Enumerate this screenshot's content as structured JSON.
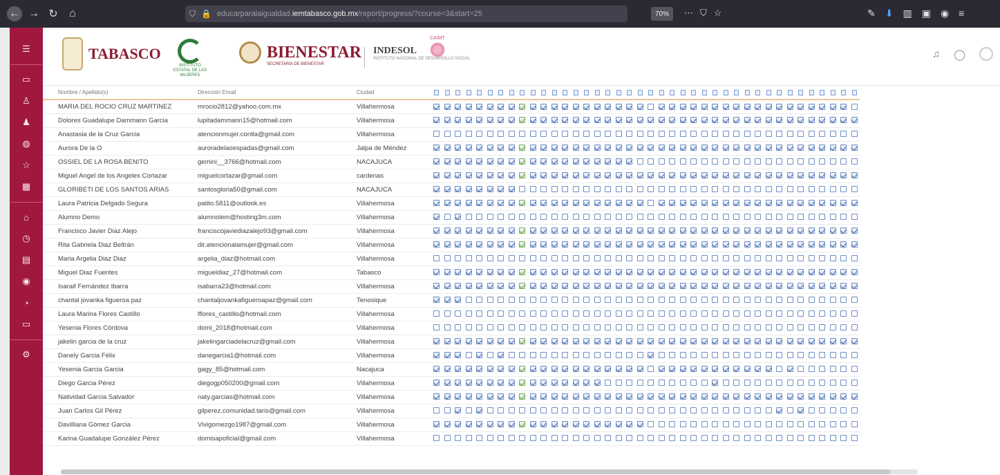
{
  "browser": {
    "url_prefix": "educarparalaigualdad.",
    "url_host": "iemtabasco.gob.mx",
    "url_path": "/report/progress/?course=3&start=25",
    "zoom": "70%"
  },
  "header": {
    "logo_tabasco": "TABASCO",
    "logo_bienestar": "BIENESTAR",
    "logo_indesol": "INDESOL",
    "logo_inst_caption": "INSTITUTO ESTATAL DE LAS MUJERES",
    "logo_bienestar_caption": "SECRETARÍA DE BIENESTAR",
    "logo_indesol_caption": "INSTITUTO NACIONAL DE DESARROLLO SOCIAL",
    "logo_pink_caption": "CAIMT"
  },
  "columns": {
    "name": "Nombre / Apellido(s)",
    "email": "Dirección Email",
    "city": "Ciudad"
  },
  "activity_count": 40,
  "rows": [
    {
      "name": "MARIA DEL ROCIO CRUZ MARTINEZ",
      "email": "mrocio2812@yahoo.com.mx",
      "city": "Villahermosa",
      "p": "1111111111111111111101111111111111111110"
    },
    {
      "name": "Dolores Guadalupe Dammann Garcia",
      "email": "lupitadammann15@hotmail.com",
      "city": "Villahermosa",
      "p": "1111111111111111111111111111111111111111"
    },
    {
      "name": "Anastasia de la Cruz Garcia",
      "email": "atencionmujer.contla@gmail.com",
      "city": "Villahermosa",
      "p": "0000000000000000000000000000000000000000"
    },
    {
      "name": "Aurora De la O",
      "email": "auroradelaoespadas@gmail.com",
      "city": "Jalpa de Méndez",
      "p": "1111111111111111111111111111111111111111"
    },
    {
      "name": "OSSIEL DE LA ROSA BENITO",
      "email": "gemini__3766@hotmail.com",
      "city": "NACAJUCA",
      "p": "1111111111111111111000000000000000000000"
    },
    {
      "name": "Miguel Angel de los Angeles Cortazar",
      "email": "miguelcortazar@gmail.com",
      "city": "cardenas",
      "p": "1111111111111111111111111111111111111111"
    },
    {
      "name": "GLORIBETI DE LOS SANTOS ARIAS",
      "email": "santosgloria50@gmail.com",
      "city": "NACAJUCA",
      "p": "1111111100000000000000000000000000000000"
    },
    {
      "name": "Laura Patricia Delgado Segura",
      "email": "patito.5811@outlook.es",
      "city": "Villahermosa",
      "p": "1111111111111111111101111111111111111111"
    },
    {
      "name": "Alumno Demo",
      "email": "alumnolem@hosting3m.com",
      "city": "Villahermosa",
      "p": "1010000000000000000000000000000000000000"
    },
    {
      "name": "Francisco Javier Diaz Alejo",
      "email": "franciscojaviediazalejo93@gmail.com",
      "city": "Villahermosa",
      "p": "1111111111111111111111111111111111111111"
    },
    {
      "name": "Rita Gabriela Diaz Beltrán",
      "email": "dir.atencionalamujer@gmail.com",
      "city": "Villahermosa",
      "p": "1111111111111111111111111111111111111111"
    },
    {
      "name": "Maria Argelia Diaz Diaz",
      "email": "argelia_diaz@hotmail.com",
      "city": "Villahermosa",
      "p": "0000000000000000000000000000000000000000"
    },
    {
      "name": "Miguel Diaz Fuentes",
      "email": "migueldiaz_27@hotmail.com",
      "city": "Tabasco",
      "p": "1111111111111111111111111111111111111111"
    },
    {
      "name": "Isaraif Fernández Ibarra",
      "email": "isabarra23@hotmail.com",
      "city": "Villahermosa",
      "p": "1111111111111111111111111111111111111111"
    },
    {
      "name": "chantal jovanka figueroa paz",
      "email": "chantaljovankafigueroapaz@gmail.com",
      "city": "Tenosique",
      "p": "1110000000000000000000000000000000000000"
    },
    {
      "name": "Laura Marina Flores Castillo",
      "email": "lflores_castillo@hotmail.com",
      "city": "Villahermosa",
      "p": "0000000000000000000000000000000000000000"
    },
    {
      "name": "Yesenia Flores Córdova",
      "email": "domi_2018@hotmail.com",
      "city": "Villahermosa",
      "p": "0000000000000000000000000000000000000000"
    },
    {
      "name": "jakelin garcia de la cruz",
      "email": "jakelingarciadelacruz@gmail.com",
      "city": "Villahermosa",
      "p": "1111111111111111111111111111111111111111"
    },
    {
      "name": "Danely Garcia Félix",
      "email": "danegarcia1@hotmail.com",
      "city": "Villahermosa",
      "p": "1110101000000000000010000000000000000000"
    },
    {
      "name": "Yesenia Garcia Garcia",
      "email": "gagy_85@hotmail.com",
      "city": "Nacajuca",
      "p": "1111111111111111111101111111111101000000"
    },
    {
      "name": "Diego Garcia Pérez",
      "email": "diegogp050200@gmail.com",
      "city": "Villahermosa",
      "p": "1111111111111111000000000010000000000000"
    },
    {
      "name": "Natividad Garcia Salvador",
      "email": "naty.garcias@hotmail.com",
      "city": "Villahermosa",
      "p": "1111111111111111111111111111111111111111"
    },
    {
      "name": "Juan Carlos Gil Pérez",
      "email": "gilperez.comunidad.taris@gmail.com",
      "city": "Villahermosa",
      "p": "0010100000000000000000000000000010100000"
    },
    {
      "name": "Davilliana Gómez Garcia",
      "email": "Vivigomezgo1987@gmail.com",
      "city": "Villahermosa",
      "p": "1111111111111111111100000000000000000000"
    },
    {
      "name": "Karina Guadalupe González Pérez",
      "email": "domisapoficial@gmail.com",
      "city": "Villahermosa",
      "p": "0000000000000000000000000000000000000000"
    }
  ],
  "colors": {
    "brand": "#a0183e",
    "checkbox": "#3b5fa6",
    "accent_green": "#5e9a28"
  }
}
